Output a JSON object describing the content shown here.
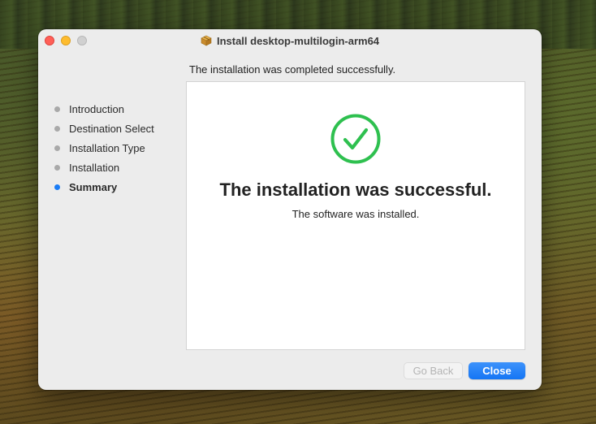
{
  "window": {
    "title": "Install desktop-multilogin-arm64",
    "icon": "package-icon"
  },
  "status_line": "The installation was completed successfully.",
  "sidebar": {
    "steps": [
      {
        "label": "Introduction",
        "active": false
      },
      {
        "label": "Destination Select",
        "active": false
      },
      {
        "label": "Installation Type",
        "active": false
      },
      {
        "label": "Installation",
        "active": false
      },
      {
        "label": "Summary",
        "active": true
      }
    ]
  },
  "main": {
    "heading": "The installation was successful.",
    "subtext": "The software was installed.",
    "icon": "checkmark-circle-icon",
    "icon_color": "#2ec04f"
  },
  "buttons": {
    "back_label": "Go Back",
    "back_enabled": false,
    "close_label": "Close"
  },
  "colors": {
    "accent": "#1a7cf5",
    "close_red": "#ff5f57",
    "minimize_yellow": "#febc2e",
    "zoom_gray": "#d0d0d0"
  }
}
